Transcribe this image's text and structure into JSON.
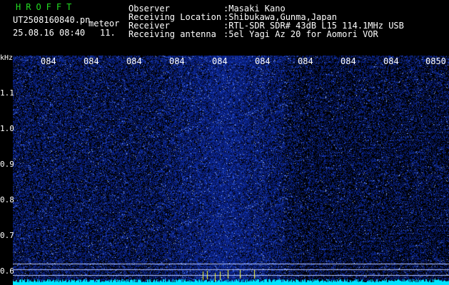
{
  "app": {
    "title": "HROFFT",
    "filename": "UT2508160840.pn",
    "mode": "meteor",
    "datetime": "25.08.16 08:40",
    "count": "11."
  },
  "info": {
    "labels": [
      "Observer",
      "Receiving Location",
      "Receiver",
      "Receiving antenna"
    ],
    "values": [
      ":Masaki Kano",
      ":Shibukawa,Gunma,Japan",
      ":RTL-SDR SDR# 43dB L15 114.1MHz USB",
      ":5el Yagi Az 20 for Aomori VOR"
    ]
  },
  "axis": {
    "freq_unit": "kHz",
    "freq_ticks": [
      "1.1",
      "1.0",
      "0.9",
      "0.8",
      "0.7",
      "0.6"
    ],
    "time_ticks": [
      "084",
      "084",
      "084",
      "084",
      "084",
      "084",
      "084",
      "084",
      "084",
      "0850"
    ]
  },
  "colors": {
    "background": "#000000",
    "signal_low": "#0a1a78",
    "signal_high": "#b0c8ff",
    "baseline": "#00e5ff",
    "title_green": "#22dd22",
    "marker_yellow": "#ffff33"
  }
}
